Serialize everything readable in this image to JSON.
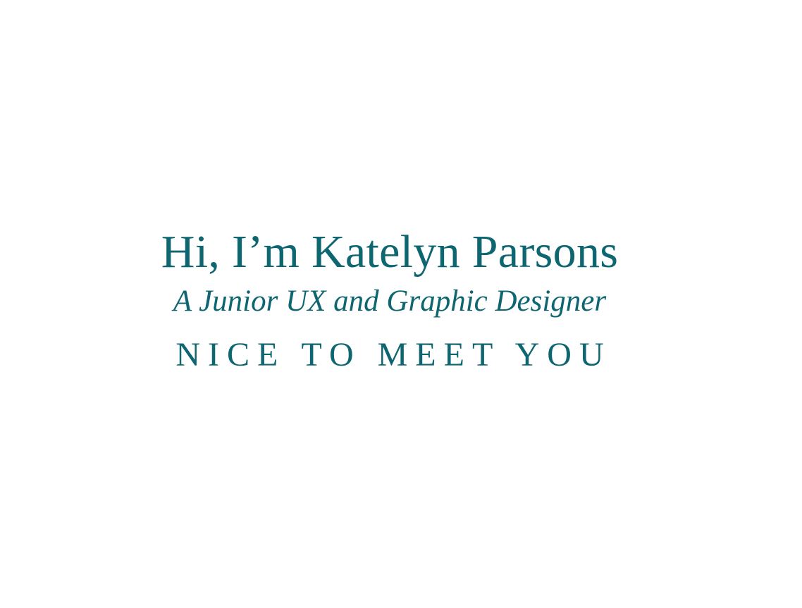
{
  "hero": {
    "name": "Hi, I’m Katelyn Parsons",
    "role": "A Junior UX and Graphic Designer",
    "greeting": "NICE TO MEET YOU"
  },
  "colors": {
    "text": "#0d6670",
    "background": "#ffffff"
  }
}
